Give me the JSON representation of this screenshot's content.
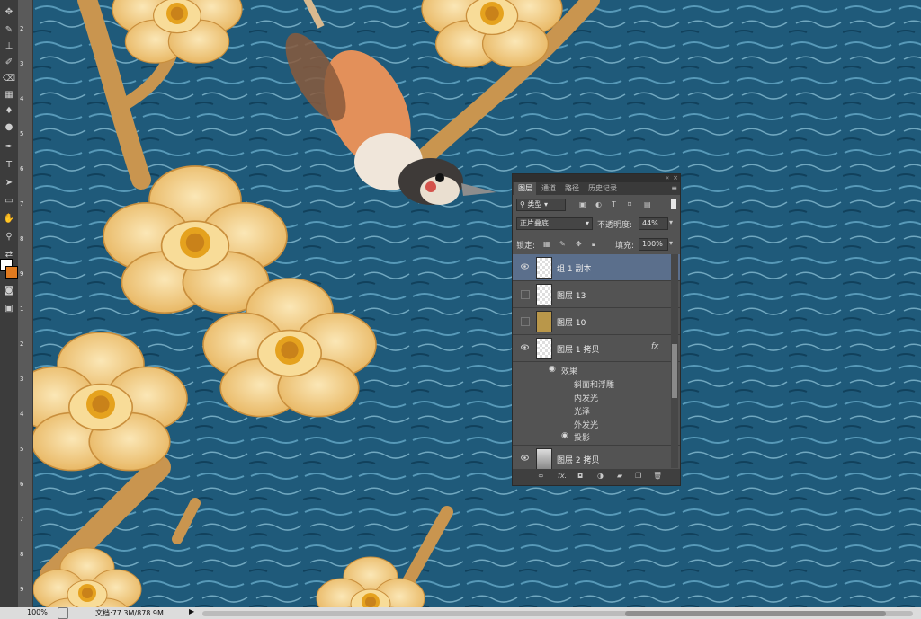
{
  "toolbar": {
    "tools": [
      "move-tool",
      "lasso-tool",
      "quick-select-tool",
      "crop-tool",
      "eyedropper-tool",
      "healing-tool",
      "brush-tool",
      "stamp-tool",
      "history-brush-tool",
      "eraser-tool",
      "gradient-tool",
      "blur-tool",
      "dodge-tool",
      "pen-tool",
      "type-tool",
      "path-select-tool",
      "shape-tool",
      "hand-tool",
      "zoom-tool"
    ]
  },
  "ruler": {
    "ticks": [
      "2",
      "3",
      "4",
      "5",
      "6",
      "7",
      "8",
      "9",
      "1",
      "2",
      "3",
      "4",
      "5",
      "6",
      "7",
      "8",
      "9"
    ]
  },
  "panel": {
    "tabs": [
      "图层",
      "通道",
      "路径",
      "历史记录"
    ],
    "filter_label": "类型",
    "blend_mode": "正片叠底",
    "opacity_label": "不透明度:",
    "opacity_value": "44%",
    "lock_label": "锁定:",
    "fill_label": "填充:",
    "fill_value": "100%",
    "layers": [
      {
        "name": "组 1 副本",
        "visible": true,
        "selected": true
      },
      {
        "name": "图层 13",
        "visible": false,
        "selected": false
      },
      {
        "name": "图层 10",
        "visible": false,
        "selected": false
      },
      {
        "name": "图层 1 拷贝",
        "visible": true,
        "selected": false,
        "fx": "fx"
      },
      {
        "name": "图层 2 拷贝",
        "visible": true,
        "selected": false
      }
    ],
    "effects_label": "效果",
    "effects": [
      "斜面和浮雕",
      "内发光",
      "光泽",
      "外发光",
      "投影"
    ],
    "footer_icons": [
      "link-icon",
      "fx-icon",
      "mask-icon",
      "adjustment-icon",
      "folder-icon",
      "new-layer-icon",
      "trash-icon"
    ],
    "fx_text": "fx."
  },
  "status": {
    "zoom": "100%",
    "doc": "文档:77.3M/878.9M"
  },
  "colors": {
    "water": "#1f5a7a",
    "petal": "#f2cf88",
    "accent": "#e07a1f",
    "selected_row": "#5b6f8c"
  }
}
